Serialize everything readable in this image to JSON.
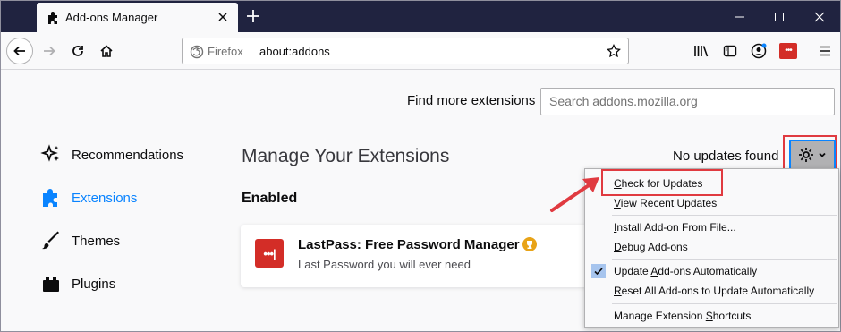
{
  "window": {
    "tab_title": "Add-ons Manager"
  },
  "urlbar": {
    "identity_label": "Firefox",
    "url": "about:addons"
  },
  "search": {
    "label": "Find more extensions",
    "placeholder": "Search addons.mozilla.org"
  },
  "sidebar": {
    "items": [
      {
        "label": "Recommendations",
        "icon": "sparkle-icon",
        "active": false
      },
      {
        "label": "Extensions",
        "icon": "puzzle-icon",
        "active": true
      },
      {
        "label": "Themes",
        "icon": "brush-icon",
        "active": false
      },
      {
        "label": "Plugins",
        "icon": "plugin-icon",
        "active": false
      }
    ]
  },
  "main": {
    "title": "Manage Your Extensions",
    "section": "Enabled",
    "update_status": "No updates found"
  },
  "extension": {
    "name": "LastPass: Free Password Manager",
    "description": "Last Password you will ever need",
    "icon_text": "•••|",
    "badge_icon": "trophy-icon"
  },
  "gear_menu": {
    "items": [
      {
        "label": "Check for Updates",
        "access_key": "C",
        "rest": "heck for Updates"
      },
      {
        "label": "View Recent Updates",
        "access_key": "V",
        "rest": "iew Recent Updates"
      },
      {
        "label": "Install Add-on From File...",
        "access_key": "I",
        "rest": "nstall Add-on From File..."
      },
      {
        "label": "Debug Add-ons",
        "access_key": "D",
        "rest": "ebug Add-ons"
      },
      {
        "label": "Update Add-ons Automatically",
        "access_key": "A",
        "pre": "Update ",
        "rest": "dd-ons Automatically",
        "checked": true
      },
      {
        "label": "Reset All Add-ons to Update Automatically",
        "access_key": "R",
        "rest": "eset All Add-ons to Update Automatically"
      },
      {
        "label": "Manage Extension Shortcuts",
        "access_key": "S",
        "pre": "Manage Extension ",
        "rest": "hortcuts"
      }
    ]
  },
  "colors": {
    "accent": "#0a84ff",
    "titlebar": "#202340",
    "highlight": "#e03a40",
    "lastpass": "#d32d27"
  }
}
